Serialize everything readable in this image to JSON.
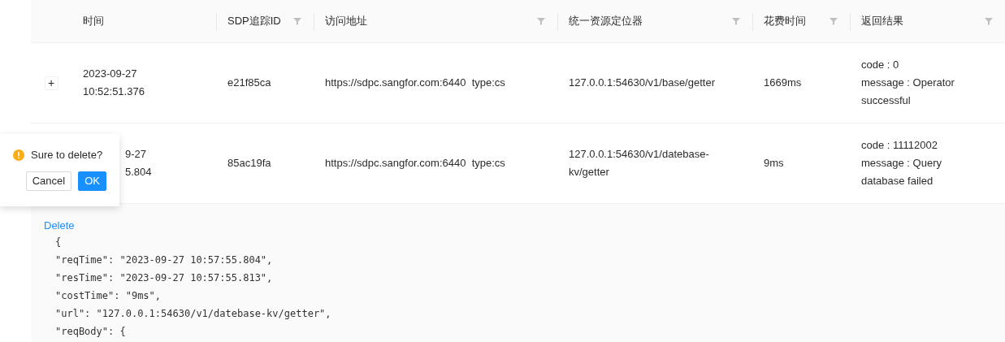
{
  "table": {
    "columns": [
      {
        "label": "时间",
        "filterable": false
      },
      {
        "label": "SDP追踪ID",
        "filterable": true
      },
      {
        "label": "访问地址",
        "filterable": true
      },
      {
        "label": "统一资源定位器",
        "filterable": true
      },
      {
        "label": "花费时间",
        "filterable": true
      },
      {
        "label": "返回结果",
        "filterable": true
      }
    ],
    "rows": [
      {
        "expanded": false,
        "expand_symbol": "+",
        "time": [
          "2023-09-27",
          "10:52:51.376"
        ],
        "trace_id": "e21f85ca",
        "address": "https://sdpc.sangfor.com:6440  type:cs",
        "url": "127.0.0.1:54630/v1/base/getter",
        "cost": "1669ms",
        "result": [
          "code : 0",
          "message : Operator successful"
        ]
      },
      {
        "expanded": true,
        "time": [
          "9-27",
          "5.804"
        ],
        "trace_id": "85ac19fa",
        "address": "https://sdpc.sangfor.com:6440  type:cs",
        "url": "127.0.0.1:54630/v1/datebase-kv/getter",
        "cost": "9ms",
        "result": [
          "code : 11112002",
          "message : Query database failed"
        ]
      }
    ],
    "expanded_detail": {
      "link": "Delete",
      "code_lines": [
        "{",
        "\"reqTime\": \"2023-09-27 10:57:55.804\",",
        "\"resTime\": \"2023-09-27 10:57:55.813\",",
        "\"costTime\": \"9ms\",",
        "\"url\": \"127.0.0.1:54630/v1/datebase-kv/getter\",",
        "\"reqBody\": {"
      ]
    }
  },
  "popconfirm": {
    "message": "Sure to delete?",
    "buttons": [
      {
        "label": "Cancel",
        "kind": "default"
      },
      {
        "label": "OK",
        "kind": "primary"
      }
    ]
  }
}
